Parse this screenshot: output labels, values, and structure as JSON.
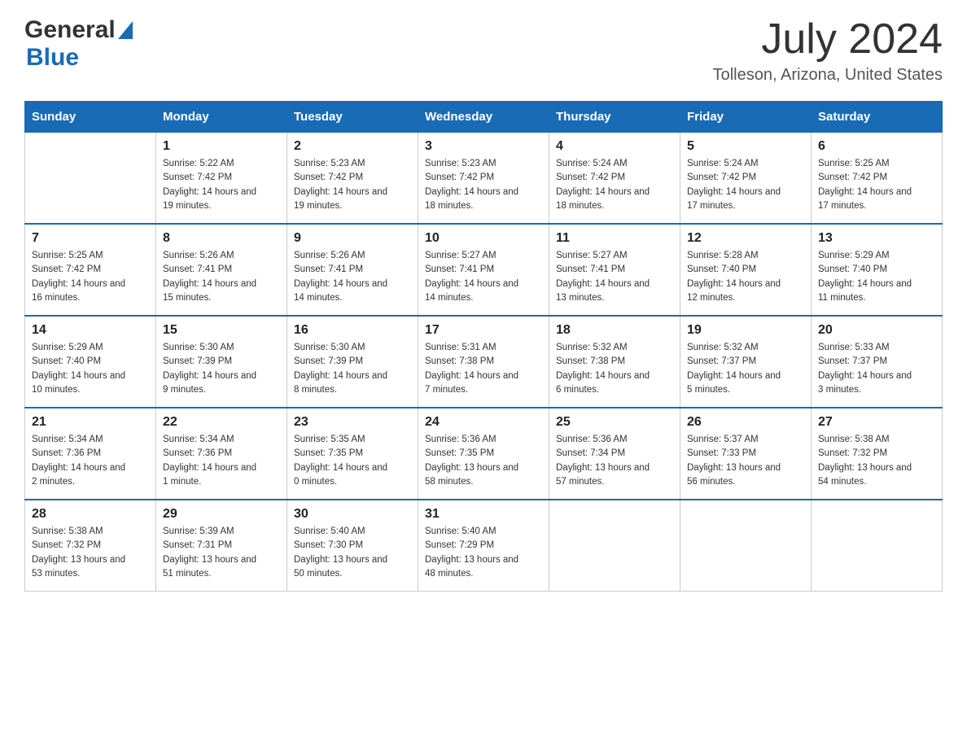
{
  "header": {
    "logo_general": "General",
    "logo_blue": "Blue",
    "month_year": "July 2024",
    "location": "Tolleson, Arizona, United States"
  },
  "calendar": {
    "days_of_week": [
      "Sunday",
      "Monday",
      "Tuesday",
      "Wednesday",
      "Thursday",
      "Friday",
      "Saturday"
    ],
    "weeks": [
      [
        {
          "day": "",
          "sunrise": "",
          "sunset": "",
          "daylight": ""
        },
        {
          "day": "1",
          "sunrise": "Sunrise: 5:22 AM",
          "sunset": "Sunset: 7:42 PM",
          "daylight": "Daylight: 14 hours and 19 minutes."
        },
        {
          "day": "2",
          "sunrise": "Sunrise: 5:23 AM",
          "sunset": "Sunset: 7:42 PM",
          "daylight": "Daylight: 14 hours and 19 minutes."
        },
        {
          "day": "3",
          "sunrise": "Sunrise: 5:23 AM",
          "sunset": "Sunset: 7:42 PM",
          "daylight": "Daylight: 14 hours and 18 minutes."
        },
        {
          "day": "4",
          "sunrise": "Sunrise: 5:24 AM",
          "sunset": "Sunset: 7:42 PM",
          "daylight": "Daylight: 14 hours and 18 minutes."
        },
        {
          "day": "5",
          "sunrise": "Sunrise: 5:24 AM",
          "sunset": "Sunset: 7:42 PM",
          "daylight": "Daylight: 14 hours and 17 minutes."
        },
        {
          "day": "6",
          "sunrise": "Sunrise: 5:25 AM",
          "sunset": "Sunset: 7:42 PM",
          "daylight": "Daylight: 14 hours and 17 minutes."
        }
      ],
      [
        {
          "day": "7",
          "sunrise": "Sunrise: 5:25 AM",
          "sunset": "Sunset: 7:42 PM",
          "daylight": "Daylight: 14 hours and 16 minutes."
        },
        {
          "day": "8",
          "sunrise": "Sunrise: 5:26 AM",
          "sunset": "Sunset: 7:41 PM",
          "daylight": "Daylight: 14 hours and 15 minutes."
        },
        {
          "day": "9",
          "sunrise": "Sunrise: 5:26 AM",
          "sunset": "Sunset: 7:41 PM",
          "daylight": "Daylight: 14 hours and 14 minutes."
        },
        {
          "day": "10",
          "sunrise": "Sunrise: 5:27 AM",
          "sunset": "Sunset: 7:41 PM",
          "daylight": "Daylight: 14 hours and 14 minutes."
        },
        {
          "day": "11",
          "sunrise": "Sunrise: 5:27 AM",
          "sunset": "Sunset: 7:41 PM",
          "daylight": "Daylight: 14 hours and 13 minutes."
        },
        {
          "day": "12",
          "sunrise": "Sunrise: 5:28 AM",
          "sunset": "Sunset: 7:40 PM",
          "daylight": "Daylight: 14 hours and 12 minutes."
        },
        {
          "day": "13",
          "sunrise": "Sunrise: 5:29 AM",
          "sunset": "Sunset: 7:40 PM",
          "daylight": "Daylight: 14 hours and 11 minutes."
        }
      ],
      [
        {
          "day": "14",
          "sunrise": "Sunrise: 5:29 AM",
          "sunset": "Sunset: 7:40 PM",
          "daylight": "Daylight: 14 hours and 10 minutes."
        },
        {
          "day": "15",
          "sunrise": "Sunrise: 5:30 AM",
          "sunset": "Sunset: 7:39 PM",
          "daylight": "Daylight: 14 hours and 9 minutes."
        },
        {
          "day": "16",
          "sunrise": "Sunrise: 5:30 AM",
          "sunset": "Sunset: 7:39 PM",
          "daylight": "Daylight: 14 hours and 8 minutes."
        },
        {
          "day": "17",
          "sunrise": "Sunrise: 5:31 AM",
          "sunset": "Sunset: 7:38 PM",
          "daylight": "Daylight: 14 hours and 7 minutes."
        },
        {
          "day": "18",
          "sunrise": "Sunrise: 5:32 AM",
          "sunset": "Sunset: 7:38 PM",
          "daylight": "Daylight: 14 hours and 6 minutes."
        },
        {
          "day": "19",
          "sunrise": "Sunrise: 5:32 AM",
          "sunset": "Sunset: 7:37 PM",
          "daylight": "Daylight: 14 hours and 5 minutes."
        },
        {
          "day": "20",
          "sunrise": "Sunrise: 5:33 AM",
          "sunset": "Sunset: 7:37 PM",
          "daylight": "Daylight: 14 hours and 3 minutes."
        }
      ],
      [
        {
          "day": "21",
          "sunrise": "Sunrise: 5:34 AM",
          "sunset": "Sunset: 7:36 PM",
          "daylight": "Daylight: 14 hours and 2 minutes."
        },
        {
          "day": "22",
          "sunrise": "Sunrise: 5:34 AM",
          "sunset": "Sunset: 7:36 PM",
          "daylight": "Daylight: 14 hours and 1 minute."
        },
        {
          "day": "23",
          "sunrise": "Sunrise: 5:35 AM",
          "sunset": "Sunset: 7:35 PM",
          "daylight": "Daylight: 14 hours and 0 minutes."
        },
        {
          "day": "24",
          "sunrise": "Sunrise: 5:36 AM",
          "sunset": "Sunset: 7:35 PM",
          "daylight": "Daylight: 13 hours and 58 minutes."
        },
        {
          "day": "25",
          "sunrise": "Sunrise: 5:36 AM",
          "sunset": "Sunset: 7:34 PM",
          "daylight": "Daylight: 13 hours and 57 minutes."
        },
        {
          "day": "26",
          "sunrise": "Sunrise: 5:37 AM",
          "sunset": "Sunset: 7:33 PM",
          "daylight": "Daylight: 13 hours and 56 minutes."
        },
        {
          "day": "27",
          "sunrise": "Sunrise: 5:38 AM",
          "sunset": "Sunset: 7:32 PM",
          "daylight": "Daylight: 13 hours and 54 minutes."
        }
      ],
      [
        {
          "day": "28",
          "sunrise": "Sunrise: 5:38 AM",
          "sunset": "Sunset: 7:32 PM",
          "daylight": "Daylight: 13 hours and 53 minutes."
        },
        {
          "day": "29",
          "sunrise": "Sunrise: 5:39 AM",
          "sunset": "Sunset: 7:31 PM",
          "daylight": "Daylight: 13 hours and 51 minutes."
        },
        {
          "day": "30",
          "sunrise": "Sunrise: 5:40 AM",
          "sunset": "Sunset: 7:30 PM",
          "daylight": "Daylight: 13 hours and 50 minutes."
        },
        {
          "day": "31",
          "sunrise": "Sunrise: 5:40 AM",
          "sunset": "Sunset: 7:29 PM",
          "daylight": "Daylight: 13 hours and 48 minutes."
        },
        {
          "day": "",
          "sunrise": "",
          "sunset": "",
          "daylight": ""
        },
        {
          "day": "",
          "sunrise": "",
          "sunset": "",
          "daylight": ""
        },
        {
          "day": "",
          "sunrise": "",
          "sunset": "",
          "daylight": ""
        }
      ]
    ]
  }
}
